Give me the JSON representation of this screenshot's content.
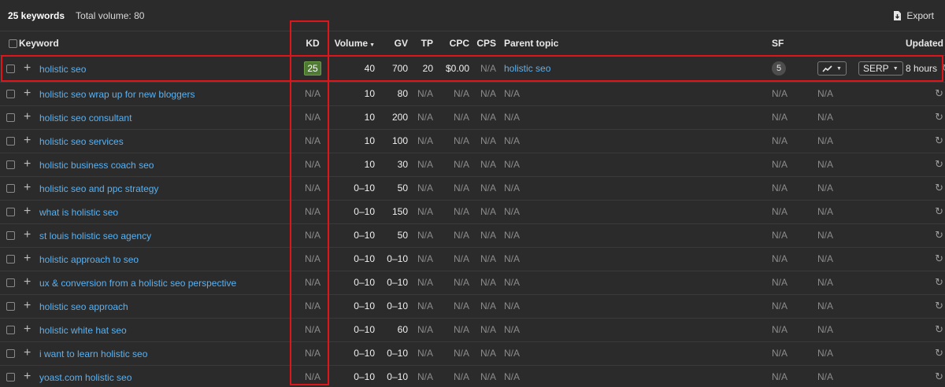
{
  "header": {
    "keyword_count": "25 keywords",
    "total_volume": "Total volume: 80",
    "export_label": "Export",
    "export_icon": "export-icon"
  },
  "columns": {
    "keyword": "Keyword",
    "kd": "KD",
    "volume": "Volume",
    "gv": "GV",
    "tp": "TP",
    "cpc": "CPC",
    "cps": "CPS",
    "parent_topic": "Parent topic",
    "sf": "SF",
    "updated": "Updated"
  },
  "first_row": {
    "keyword": "holistic seo",
    "kd": "25",
    "volume": "40",
    "gv": "700",
    "tp": "20",
    "cpc": "$0.00",
    "cps": "N/A",
    "parent_topic": "holistic seo",
    "sf": "5",
    "trend_icon": "trend-line-icon",
    "serp_label": "SERP",
    "updated": "8 hours"
  },
  "rows": [
    {
      "keyword": "holistic seo wrap up for new bloggers",
      "kd": "N/A",
      "volume": "10",
      "gv": "80",
      "tp": "N/A",
      "cpc": "N/A",
      "cps": "N/A",
      "parent_topic": "N/A",
      "sf": "N/A",
      "trend": "N/A"
    },
    {
      "keyword": "holistic seo consultant",
      "kd": "N/A",
      "volume": "10",
      "gv": "200",
      "tp": "N/A",
      "cpc": "N/A",
      "cps": "N/A",
      "parent_topic": "N/A",
      "sf": "N/A",
      "trend": "N/A"
    },
    {
      "keyword": "holistic seo services",
      "kd": "N/A",
      "volume": "10",
      "gv": "100",
      "tp": "N/A",
      "cpc": "N/A",
      "cps": "N/A",
      "parent_topic": "N/A",
      "sf": "N/A",
      "trend": "N/A"
    },
    {
      "keyword": "holistic business coach seo",
      "kd": "N/A",
      "volume": "10",
      "gv": "30",
      "tp": "N/A",
      "cpc": "N/A",
      "cps": "N/A",
      "parent_topic": "N/A",
      "sf": "N/A",
      "trend": "N/A"
    },
    {
      "keyword": "holistic seo and ppc strategy",
      "kd": "N/A",
      "volume": "0–10",
      "gv": "50",
      "tp": "N/A",
      "cpc": "N/A",
      "cps": "N/A",
      "parent_topic": "N/A",
      "sf": "N/A",
      "trend": "N/A"
    },
    {
      "keyword": "what is holistic seo",
      "kd": "N/A",
      "volume": "0–10",
      "gv": "150",
      "tp": "N/A",
      "cpc": "N/A",
      "cps": "N/A",
      "parent_topic": "N/A",
      "sf": "N/A",
      "trend": "N/A"
    },
    {
      "keyword": "st louis holistic seo agency",
      "kd": "N/A",
      "volume": "0–10",
      "gv": "50",
      "tp": "N/A",
      "cpc": "N/A",
      "cps": "N/A",
      "parent_topic": "N/A",
      "sf": "N/A",
      "trend": "N/A"
    },
    {
      "keyword": "holistic approach to seo",
      "kd": "N/A",
      "volume": "0–10",
      "gv": "0–10",
      "tp": "N/A",
      "cpc": "N/A",
      "cps": "N/A",
      "parent_topic": "N/A",
      "sf": "N/A",
      "trend": "N/A"
    },
    {
      "keyword": "ux & conversion from a holistic seo perspective",
      "kd": "N/A",
      "volume": "0–10",
      "gv": "0–10",
      "tp": "N/A",
      "cpc": "N/A",
      "cps": "N/A",
      "parent_topic": "N/A",
      "sf": "N/A",
      "trend": "N/A"
    },
    {
      "keyword": "holistic seo approach",
      "kd": "N/A",
      "volume": "0–10",
      "gv": "0–10",
      "tp": "N/A",
      "cpc": "N/A",
      "cps": "N/A",
      "parent_topic": "N/A",
      "sf": "N/A",
      "trend": "N/A"
    },
    {
      "keyword": "holistic white hat seo",
      "kd": "N/A",
      "volume": "0–10",
      "gv": "60",
      "tp": "N/A",
      "cpc": "N/A",
      "cps": "N/A",
      "parent_topic": "N/A",
      "sf": "N/A",
      "trend": "N/A"
    },
    {
      "keyword": "i want to learn holistic seo",
      "kd": "N/A",
      "volume": "0–10",
      "gv": "0–10",
      "tp": "N/A",
      "cpc": "N/A",
      "cps": "N/A",
      "parent_topic": "N/A",
      "sf": "N/A",
      "trend": "N/A"
    },
    {
      "keyword": "yoast.com holistic seo",
      "kd": "N/A",
      "volume": "0–10",
      "gv": "0–10",
      "tp": "N/A",
      "cpc": "N/A",
      "cps": "N/A",
      "parent_topic": "N/A",
      "sf": "N/A",
      "trend": "N/A"
    }
  ],
  "colors": {
    "background": "#2b2b2b",
    "link": "#5bb1f0",
    "kd_badge": "#4f7a34",
    "highlight": "#e0141b",
    "muted": "#8c8c8c"
  }
}
